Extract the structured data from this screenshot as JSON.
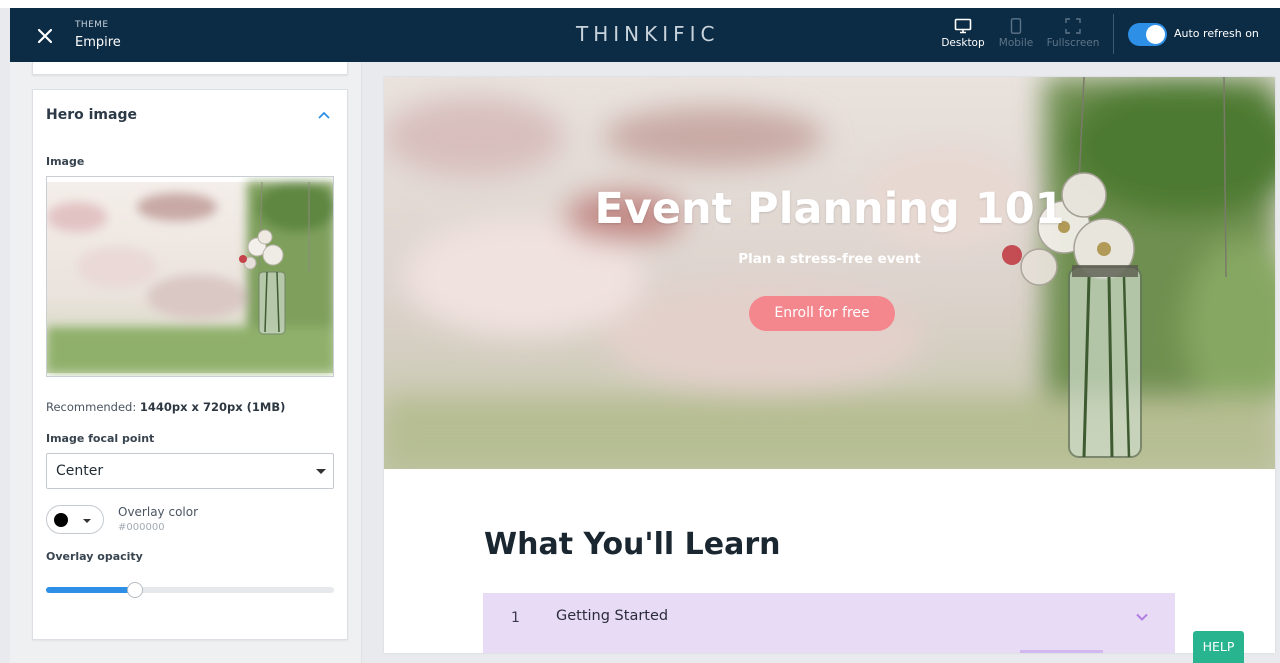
{
  "header": {
    "theme_label": "THEME",
    "theme_name": "Empire",
    "brand": "THINKIFIC",
    "views": [
      {
        "label": "Desktop",
        "icon": "desktop-icon",
        "active": true
      },
      {
        "label": "Mobile",
        "icon": "mobile-icon",
        "active": false
      },
      {
        "label": "Fullscreen",
        "icon": "fullscreen-icon",
        "active": false
      }
    ],
    "auto_refresh": {
      "label": "Auto refresh on",
      "on": true
    },
    "colors": {
      "bar": "#0c2b44",
      "accent": "#2d8fe6"
    }
  },
  "sidebar": {
    "panel_title": "Hero image",
    "image_label": "Image",
    "recommended_prefix": "Recommended:",
    "recommended_value": "1440px x 720px (1MB)",
    "focal_label": "Image focal point",
    "focal_value": "Center",
    "overlay_color_label": "Overlay color",
    "overlay_color_value": "#000000",
    "overlay_opacity_label": "Overlay opacity",
    "overlay_opacity": 0.31
  },
  "preview": {
    "hero_title": "Event Planning 101",
    "hero_subtitle": "Plan a stress-free event",
    "enroll_label": "Enroll for free",
    "enroll_color": "#f4868d",
    "section_title": "What You'll Learn",
    "chapters": [
      {
        "number": "1",
        "title": "Getting Started"
      }
    ],
    "chapter_color": "#e8dbf6"
  },
  "help": {
    "label": "HELP",
    "color": "#27b48f"
  }
}
